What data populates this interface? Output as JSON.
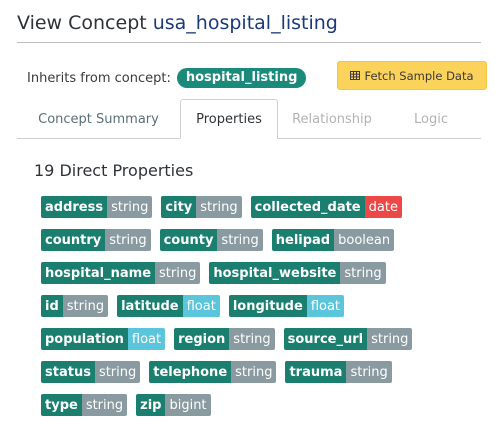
{
  "header": {
    "title_prefix": "View Concept",
    "concept_name": "usa_hospital_listing"
  },
  "inherits": {
    "label": "Inherits from concept:",
    "parent": "hospital_listing"
  },
  "fetch_button": {
    "icon": "table-icon",
    "label": "Fetch Sample Data"
  },
  "tabs": [
    {
      "label": "Concept Summary",
      "state": "normal"
    },
    {
      "label": "Properties",
      "state": "active"
    },
    {
      "label": "Relationship",
      "state": "disabled"
    },
    {
      "label": "Logic",
      "state": "disabled"
    }
  ],
  "section_title": "19 Direct Properties",
  "type_colors": {
    "string": "#8a9aa1",
    "boolean": "#8a9aa1",
    "bigint": "#8a9aa1",
    "float": "#5bc5dc",
    "date": "#ec4848",
    "name": "#1a7f6f"
  },
  "property_rows": [
    [
      {
        "name": "address",
        "type": "string"
      },
      {
        "name": "city",
        "type": "string"
      },
      {
        "name": "collected_date",
        "type": "date"
      }
    ],
    [
      {
        "name": "country",
        "type": "string"
      },
      {
        "name": "county",
        "type": "string"
      },
      {
        "name": "helipad",
        "type": "boolean"
      }
    ],
    [
      {
        "name": "hospital_name",
        "type": "string"
      },
      {
        "name": "hospital_website",
        "type": "string"
      }
    ],
    [
      {
        "name": "id",
        "type": "string"
      },
      {
        "name": "latitude",
        "type": "float"
      },
      {
        "name": "longitude",
        "type": "float"
      }
    ],
    [
      {
        "name": "population",
        "type": "float"
      },
      {
        "name": "region",
        "type": "string"
      },
      {
        "name": "source_url",
        "type": "string"
      }
    ],
    [
      {
        "name": "status",
        "type": "string"
      },
      {
        "name": "telephone",
        "type": "string"
      },
      {
        "name": "trauma",
        "type": "string"
      }
    ],
    [
      {
        "name": "type",
        "type": "string"
      },
      {
        "name": "zip",
        "type": "bigint"
      }
    ]
  ]
}
